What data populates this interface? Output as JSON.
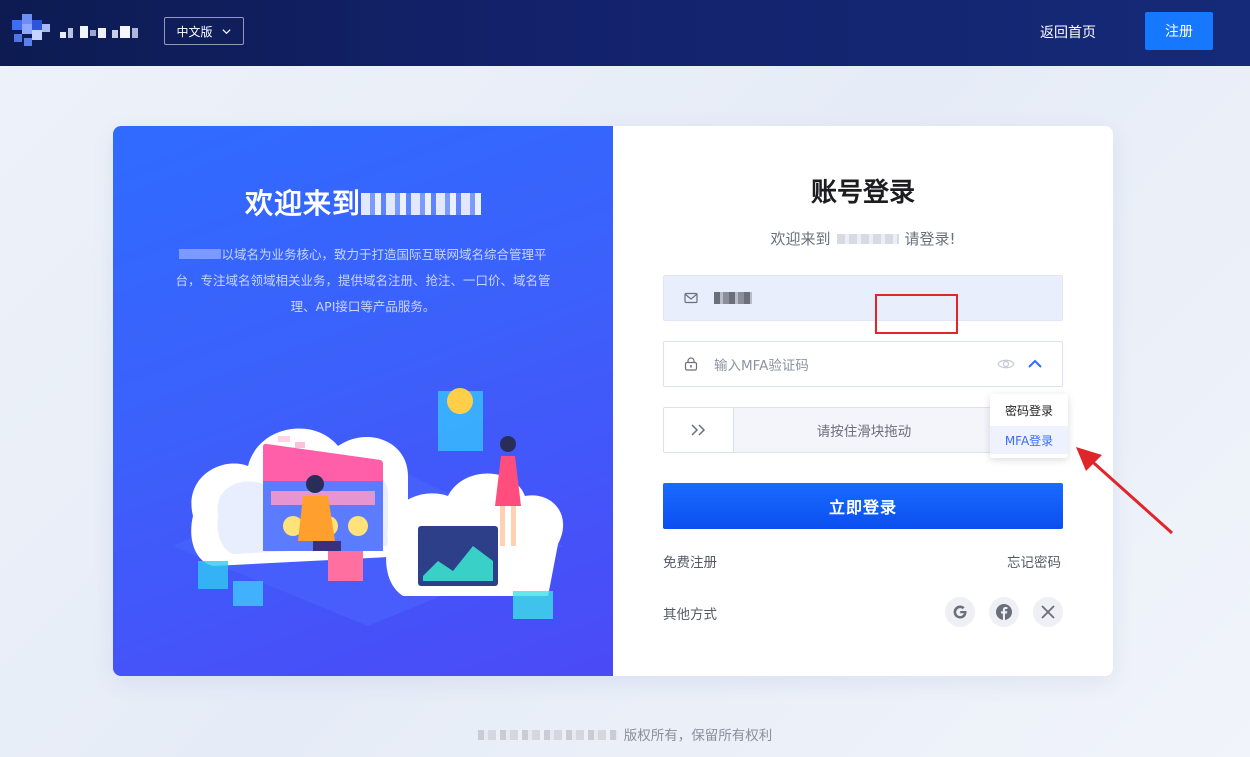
{
  "header": {
    "language": "中文版",
    "home_link": "返回首页",
    "register_button": "注册"
  },
  "promo": {
    "title_prefix": "欢迎来到",
    "description": "以域名为业务核心，致力于打造国际互联网域名综合管理平台，专注域名领域相关业务，提供域名注册、抢注、一口价、域名管理、API接口等产品服务。"
  },
  "form": {
    "title": "账号登录",
    "subtitle_prefix": "欢迎来到",
    "subtitle_suffix": "请登录!",
    "mfa_placeholder": "输入MFA验证码",
    "slider_text": "请按住滑块拖动",
    "login_methods": [
      "密码登录",
      "MFA登录"
    ],
    "submit": "立即登录",
    "free_register": "免费注册",
    "forgot_password": "忘记密码",
    "other_methods": "其他方式",
    "social_icons": [
      "google-icon",
      "facebook-icon",
      "x-icon"
    ]
  },
  "footer": {
    "copyright": "版权所有，保留所有权利"
  },
  "colors": {
    "header_bg": "#13216a",
    "primary": "#1677ff",
    "promo_gradient_start": "#2f6bff",
    "promo_gradient_end": "#4b4af7",
    "highlight": "#e0262a"
  }
}
